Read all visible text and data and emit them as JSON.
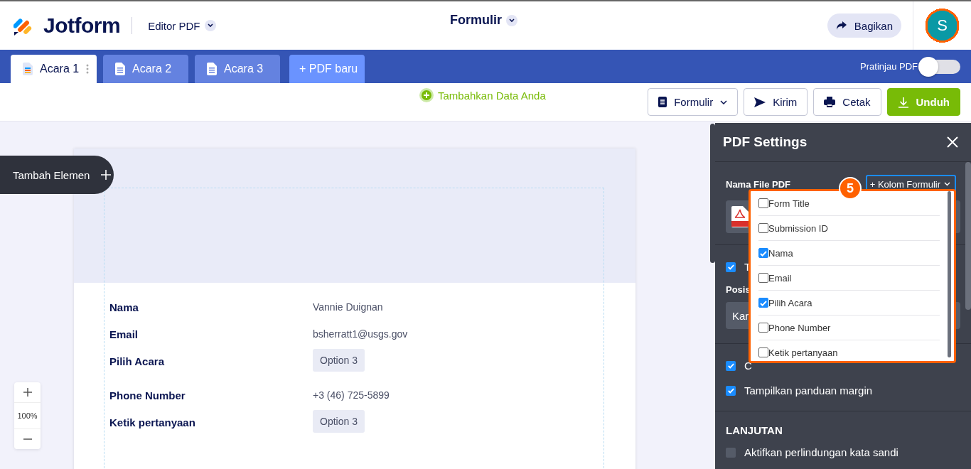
{
  "header": {
    "logo": "Jotform",
    "editor_menu": "Editor PDF",
    "form_title": "Formulir",
    "share_button": "Bagikan",
    "avatar": "S"
  },
  "tabs": [
    {
      "label": "Acara 1",
      "selected": true
    },
    {
      "label": "Acara 2",
      "selected": false
    },
    {
      "label": "Acara 3",
      "selected": false
    }
  ],
  "new_pdf_button": "+ PDF baru",
  "preview_toggle": {
    "label": "Pratinjau PDF",
    "on": false
  },
  "toolbar": {
    "add_data": "Tambahkan Data Anda",
    "buttons": [
      {
        "label": "Formulir",
        "kind": "menu"
      },
      {
        "label": "Kirim",
        "kind": "send"
      },
      {
        "label": "Cetak",
        "kind": "print"
      },
      {
        "label": "Unduh",
        "kind": "download"
      }
    ]
  },
  "add_element": "Tambah Elemen",
  "zoom": "100%",
  "document": {
    "fields": [
      {
        "label": "Nama",
        "value": "Vannie Duignan",
        "kind": "text"
      },
      {
        "label": "Email",
        "value": "bsherratt1@usgs.gov",
        "kind": "text"
      },
      {
        "label": "Pilih Acara",
        "value": "Option 3",
        "kind": "option"
      },
      {
        "label": "Phone Number",
        "value": "+3 (46) 725-5899",
        "kind": "text"
      },
      {
        "label": "Ketik pertanyaan",
        "value": "Option 3",
        "kind": "option"
      }
    ]
  },
  "settings_panel": {
    "title": "PDF Settings",
    "file_name_label": "Nama File PDF",
    "add_field_button": "+ Kolom Formulir",
    "field_menu": {
      "badge": "5",
      "items": [
        {
          "label": "Form Title",
          "checked": false
        },
        {
          "label": "Submission ID",
          "checked": false
        },
        {
          "label": "Nama",
          "checked": true
        },
        {
          "label": "Email",
          "checked": false
        },
        {
          "label": "Pilih Acara",
          "checked": true
        },
        {
          "label": "Phone Number",
          "checked": false
        },
        {
          "label": "Ketik pertanyaan",
          "checked": false
        }
      ]
    },
    "option_1": {
      "label": "T",
      "checked": true
    },
    "position_label": "Posis",
    "position_select": "Kar",
    "option_2": {
      "label": "C",
      "checked": true
    },
    "option_3": {
      "label": "Tampilkan panduan margin",
      "checked": true
    },
    "section_title": "LANJUTAN",
    "option_4": {
      "label": "Aktifkan perlindungan kata sandi",
      "checked": false
    }
  }
}
